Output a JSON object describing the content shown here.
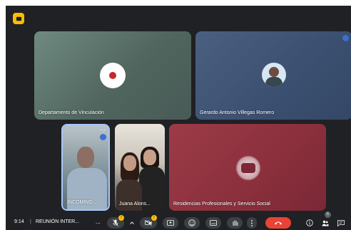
{
  "tiles": {
    "vinculacion": {
      "label": "Departamento de Vinculación"
    },
    "gerardo": {
      "label": "Gerardo Antonio Villegas Romero"
    },
    "incoming": {
      "label": "INCOMING ..."
    },
    "juana": {
      "label": "Juana Alons..."
    },
    "residencias": {
      "label": "Residencias Profesionales y Servicio Social"
    }
  },
  "bottom_bar": {
    "time": "9:14",
    "separator": "|",
    "meeting_name": "REUNIÓN INTER...",
    "more": "..."
  },
  "controls": {
    "mic_badge": "!",
    "cam_badge": "!",
    "participants_count": "5"
  },
  "icons": {
    "top_badge": "yellow-square-icon",
    "mic": "mic-off-icon",
    "chevron": "chevron-up-icon",
    "camera": "camera-off-icon",
    "present": "present-icon",
    "emoji": "emoji-icon",
    "captions": "captions-icon",
    "hand": "raise-hand-icon",
    "more": "more-vertical-icon",
    "end": "end-call-icon",
    "info": "info-icon",
    "people": "people-icon",
    "chat": "chat-icon"
  },
  "colors": {
    "accent": "#a8c7fa",
    "end_call": "#ea4335",
    "badge": "#fbbc04"
  }
}
